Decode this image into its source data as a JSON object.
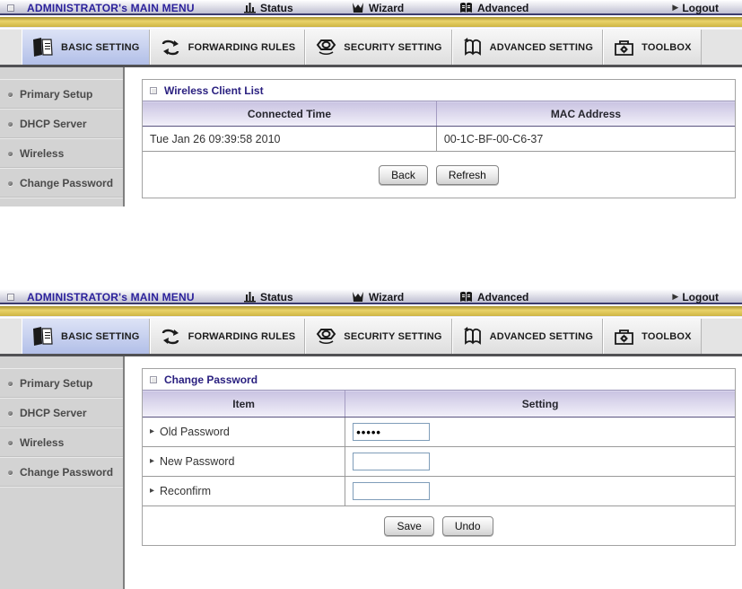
{
  "header": {
    "title": "ADMINISTRATOR's MAIN MENU",
    "menu_items": [
      {
        "label": "Status"
      },
      {
        "label": "Wizard"
      },
      {
        "label": "Advanced"
      }
    ],
    "logout_label": "Logout"
  },
  "tabs": [
    {
      "label": "BASIC SETTING",
      "active": true
    },
    {
      "label": "FORWARDING RULES",
      "active": false
    },
    {
      "label": "SECURITY SETTING",
      "active": false
    },
    {
      "label": "ADVANCED SETTING",
      "active": false
    },
    {
      "label": "TOOLBOX",
      "active": false
    }
  ],
  "sidebar": {
    "items": [
      {
        "label": "Primary Setup"
      },
      {
        "label": "DHCP Server"
      },
      {
        "label": "Wireless"
      },
      {
        "label": "Change Password"
      }
    ]
  },
  "panel1": {
    "title": "Wireless Client List",
    "table": {
      "headers": [
        "Connected Time",
        "MAC Address"
      ],
      "rows": [
        [
          "Tue Jan 26 09:39:58 2010",
          "00-1C-BF-00-C6-37"
        ]
      ]
    },
    "buttons": [
      {
        "label": "Back"
      },
      {
        "label": "Refresh"
      }
    ]
  },
  "panel2": {
    "title": "Change Password",
    "table": {
      "headers": [
        "Item",
        "Setting"
      ],
      "rows": [
        {
          "label": "Old Password",
          "value": "•••••"
        },
        {
          "label": "New Password",
          "value": ""
        },
        {
          "label": "Reconfirm",
          "value": ""
        }
      ]
    },
    "buttons": [
      {
        "label": "Save"
      },
      {
        "label": "Undo"
      }
    ]
  },
  "icons": {
    "logout_arrow": "▶",
    "row_marker": "▸"
  },
  "colors": {
    "accent_navy": "#2a2080",
    "menu_title": "#2b219b",
    "gold_bar": "#d6bd4c",
    "active_tab": "#b2bfe8",
    "header_row_lavender": "#c9c3e2",
    "sidebar_bg": "#d3d3d3",
    "input_border": "#7f9db9"
  }
}
